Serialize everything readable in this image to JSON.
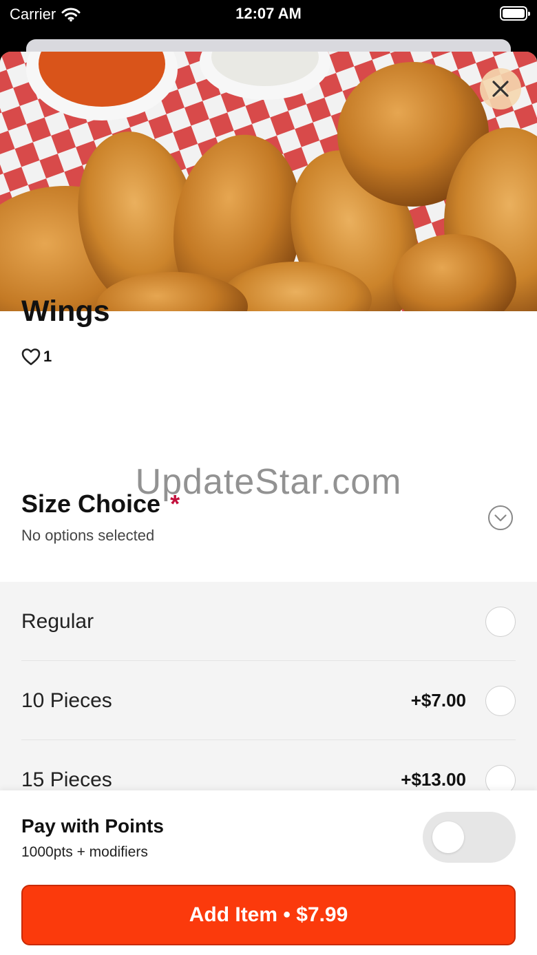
{
  "status_bar": {
    "carrier": "Carrier",
    "time": "12:07 AM"
  },
  "item": {
    "title": "Wings",
    "likes": "1"
  },
  "watermark": "UpdateStar.com",
  "size_choice": {
    "title": "Size Choice",
    "required_mark": "*",
    "subtitle": "No options selected",
    "options": [
      {
        "label": "Regular",
        "price": ""
      },
      {
        "label": "10 Pieces",
        "price": "+$7.00"
      },
      {
        "label": "15 Pieces",
        "price": "+$13.00"
      }
    ]
  },
  "footer": {
    "points_title": "Pay with Points",
    "points_subtitle": "1000pts + modifiers",
    "toggle_on": false,
    "add_button_label": "Add Item • $7.99"
  },
  "colors": {
    "accent": "#fb3a0c",
    "required": "#c2103c"
  },
  "icons": [
    "wifi-icon",
    "battery-icon",
    "close-icon",
    "heart-icon",
    "chevron-down-icon"
  ]
}
